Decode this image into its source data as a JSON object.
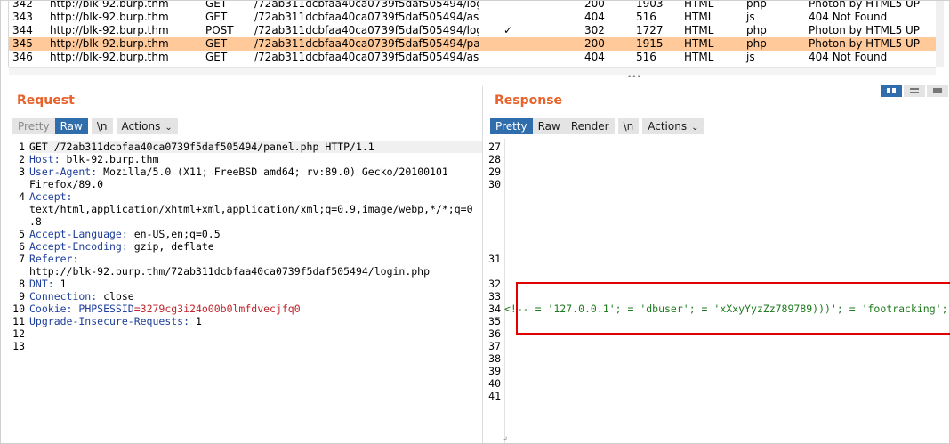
{
  "history": {
    "rows": [
      {
        "num": "342",
        "host": "http://blk-92.burp.thm",
        "method": "GET",
        "url": "/72ab311dcbfaa40ca0739f5daf505494/log...",
        "edited": "",
        "status": "200",
        "length": "1903",
        "mime": "HTML",
        "ext": "php",
        "title": "Photon by HTML5 UP"
      },
      {
        "num": "343",
        "host": "http://blk-92.burp.thm",
        "method": "GET",
        "url": "/72ab311dcbfaa40ca0739f5daf505494/as...",
        "edited": "",
        "status": "404",
        "length": "516",
        "mime": "HTML",
        "ext": "js",
        "title": "404 Not Found"
      },
      {
        "num": "344",
        "host": "http://blk-92.burp.thm",
        "method": "POST",
        "url": "/72ab311dcbfaa40ca0739f5daf505494/log...",
        "edited": "✓",
        "status": "302",
        "length": "1727",
        "mime": "HTML",
        "ext": "php",
        "title": "Photon by HTML5 UP"
      },
      {
        "num": "345",
        "host": "http://blk-92.burp.thm",
        "method": "GET",
        "url": "/72ab311dcbfaa40ca0739f5daf505494/pa...",
        "edited": "",
        "status": "200",
        "length": "1915",
        "mime": "HTML",
        "ext": "php",
        "title": "Photon by HTML5 UP"
      },
      {
        "num": "346",
        "host": "http://blk-92.burp.thm",
        "method": "GET",
        "url": "/72ab311dcbfaa40ca0739f5daf505494/as...",
        "edited": "",
        "status": "404",
        "length": "516",
        "mime": "HTML",
        "ext": "js",
        "title": "404 Not Found"
      }
    ],
    "selected_row": "345"
  },
  "request": {
    "title": "Request",
    "tabs": {
      "pretty": "Pretty",
      "raw": "Raw",
      "newline": "\\n",
      "actions": "Actions"
    },
    "line_numbers": [
      "1",
      "2",
      "3",
      "4",
      "5",
      "6",
      "7",
      "8",
      "9",
      "10",
      "11",
      "12",
      "13"
    ],
    "l1": "GET /72ab311dcbfaa40ca0739f5daf505494/panel.php HTTP/1.1",
    "l2_key": "Host:",
    "l2_val": " blk-92.burp.thm",
    "l3_key": "User-Agent:",
    "l3_val": " Mozilla/5.0 (X11; FreeBSD amd64; rv:89.0) Gecko/20100101",
    "l3_cont": "Firefox/89.0",
    "l4_key": "Accept:",
    "l4_cont1": "text/html,application/xhtml+xml,application/xml;q=0.9,image/webp,*/*;q=0",
    "l4_cont2": ".8",
    "l5_key": "Accept-Language:",
    "l5_val": " en-US,en;q=0.5",
    "l6_key": "Accept-Encoding:",
    "l6_val": " gzip, deflate",
    "l7_key": "Referer:",
    "l7_cont": "http://blk-92.burp.thm/72ab311dcbfaa40ca0739f5daf505494/login.php",
    "l8_key": "DNT:",
    "l8_val": " 1",
    "l9_key": "Connection:",
    "l9_val": " close",
    "l10_key": "Cookie:",
    "l10_cookie_name": " PHPSESSID",
    "l10_cookie_val": "=3279cg3i24o00b0lmfdvecjfq0",
    "l11_key": "Upgrade-Insecure-Requests:",
    "l11_val": " 1"
  },
  "response": {
    "title": "Response",
    "tabs": {
      "pretty": "Pretty",
      "raw": "Raw",
      "render": "Render",
      "newline": "\\n",
      "actions": "Actions"
    },
    "line_numbers_top": [
      "27",
      "28",
      "29",
      "30"
    ],
    "line_31": "31",
    "line_numbers_mid": [
      "32",
      "33"
    ],
    "line_34": "34",
    "line_numbers_bot": [
      "35",
      "36",
      "37",
      "38",
      "39",
      "40",
      "41"
    ],
    "l34_code": "<!-- = '127.0.0.1'; = 'dbuser'; = 'xXxyYyzZz789789)))'; = 'footracking';"
  },
  "colors": {
    "accent": "#e8632c",
    "selected_row": "#ffc99a",
    "active_tab": "#2f6dad",
    "annotation": "#e10000"
  }
}
